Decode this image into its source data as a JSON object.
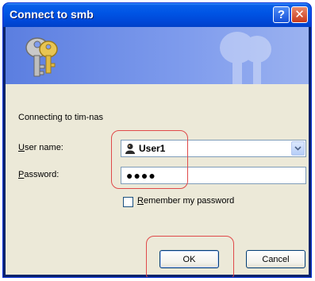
{
  "window": {
    "title": "Connect to smb",
    "help_label": "?",
    "close_label": "✕"
  },
  "dialog": {
    "connecting_text": "Connecting to tim-nas",
    "username_label_accel": "U",
    "username_label_rest": "ser name:",
    "username_value": "User1",
    "password_label_accel": "P",
    "password_label_rest": "assword:",
    "password_value": "●●●●",
    "remember_accel": "R",
    "remember_rest": "emember my password",
    "remember_checked": false,
    "ok_label": "OK",
    "cancel_label": "Cancel"
  },
  "colors": {
    "annotation": "#e04a4a",
    "titlebar": "#0055e5"
  }
}
